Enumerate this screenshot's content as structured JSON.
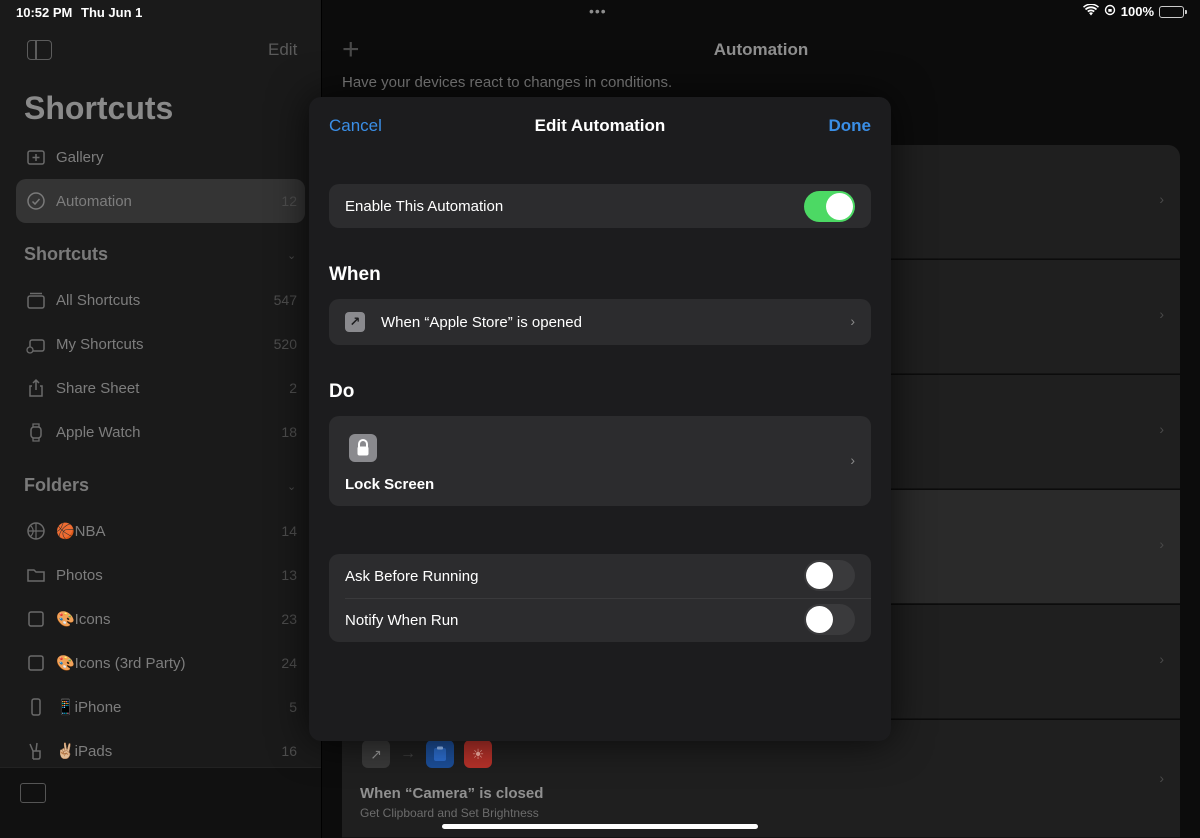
{
  "status_bar": {
    "time": "10:52 PM",
    "date": "Thu Jun 1",
    "battery": "100%",
    "multitask_dots": "•••"
  },
  "sidebar": {
    "edit_label": "Edit",
    "title": "Shortcuts",
    "top_items": [
      {
        "label": "Gallery",
        "count": "",
        "icon": "gallery-icon"
      },
      {
        "label": "Automation",
        "count": "12",
        "icon": "clock-icon"
      }
    ],
    "shortcuts_header": "Shortcuts",
    "shortcut_items": [
      {
        "label": "All Shortcuts",
        "count": "547",
        "icon": "stack-icon"
      },
      {
        "label": "My Shortcuts",
        "count": "520",
        "icon": "person-stack-icon"
      },
      {
        "label": "Share Sheet",
        "count": "2",
        "icon": "share-icon"
      },
      {
        "label": "Apple Watch",
        "count": "18",
        "icon": "watch-icon"
      }
    ],
    "folders_header": "Folders",
    "folder_items": [
      {
        "label": "🏀NBA",
        "count": "14",
        "icon": "basketball-icon"
      },
      {
        "label": "Photos",
        "count": "13",
        "icon": "folder-icon"
      },
      {
        "label": "🎨Icons",
        "count": "23",
        "icon": "square-icon"
      },
      {
        "label": "🎨Icons (3rd Party)",
        "count": "24",
        "icon": "square-icon"
      },
      {
        "label": "📱iPhone",
        "count": "5",
        "icon": "phone-icon"
      },
      {
        "label": "✌🏼iPads",
        "count": "16",
        "icon": "peace-icon"
      }
    ]
  },
  "main": {
    "title": "Automation",
    "subtitle": "Have your devices react to changes in conditions.",
    "last_card": {
      "title": "When “Camera” is closed",
      "subtitle": "Get Clipboard and Set Brightness"
    }
  },
  "modal": {
    "cancel_label": "Cancel",
    "title": "Edit Automation",
    "done_label": "Done",
    "enable_label": "Enable This Automation",
    "enable_on": true,
    "when_header": "When",
    "when_trigger": "When “Apple Store” is opened",
    "do_header": "Do",
    "do_action": "Lock Screen",
    "ask_label": "Ask Before Running",
    "ask_on": false,
    "notify_label": "Notify When Run",
    "notify_on": false
  },
  "colors": {
    "accent": "#3a8ee6",
    "toggle_on": "#4cd964"
  }
}
